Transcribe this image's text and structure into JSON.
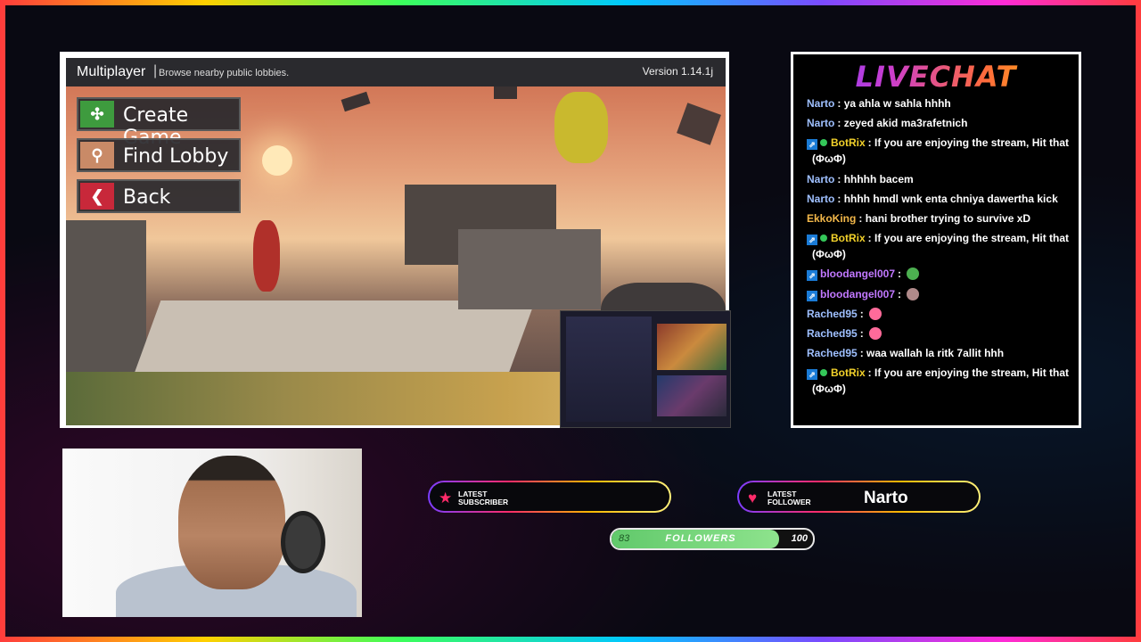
{
  "game": {
    "title": "Multiplayer",
    "separator": "|",
    "subtitle": "Browse nearby public lobbies.",
    "version": "Version 1.14.1j",
    "menu": [
      {
        "label": "Create Game",
        "icon": "network-icon",
        "color": "#3e9b3e"
      },
      {
        "label": "Find Lobby",
        "icon": "search-icon",
        "color": "#c98a67"
      },
      {
        "label": "Back",
        "icon": "back-arrow-icon",
        "color": "#c8283a"
      }
    ]
  },
  "livechat": {
    "title": "LIVECHAT",
    "messages": [
      {
        "user": "Narto",
        "user_color": "#9fc0ff",
        "text": "ya ahla w sahla hhhh"
      },
      {
        "user": "Narto",
        "user_color": "#9fc0ff",
        "text": "zeyed akid ma3rafetnich"
      },
      {
        "user": "BotRix",
        "user_color": "#f2d12a",
        "bot": true,
        "text": "If you are enjoying the stream, Hit that",
        "text2": "(ΦωΦ)"
      },
      {
        "user": "Narto",
        "user_color": "#9fc0ff",
        "text": "hhhhh bacem"
      },
      {
        "user": "Narto",
        "user_color": "#9fc0ff",
        "text": "hhhh hmdl wnk enta chniya dawertha kick"
      },
      {
        "user": "EkkoKing",
        "user_color": "#f3b84a",
        "text": "hani brother trying to survive xD"
      },
      {
        "user": "BotRix",
        "user_color": "#f2d12a",
        "bot": true,
        "text": "If you are enjoying the stream, Hit that",
        "text2": "(ΦωΦ)"
      },
      {
        "user": "bloodangel007",
        "user_color": "#c178ff",
        "badge": true,
        "text": "",
        "emote": "green-face"
      },
      {
        "user": "bloodangel007",
        "user_color": "#c178ff",
        "badge": true,
        "text": "",
        "emote": "cat-face"
      },
      {
        "user": "Rached95",
        "user_color": "#9fc0ff",
        "text": "",
        "emote": "pink-feather"
      },
      {
        "user": "Rached95",
        "user_color": "#9fc0ff",
        "text": "",
        "emote": "pink-feather"
      },
      {
        "user": "Rached95",
        "user_color": "#9fc0ff",
        "text": "waa wallah la ritk 7allit hhh"
      },
      {
        "user": "BotRix",
        "user_color": "#f2d12a",
        "bot": true,
        "text": "If you are enjoying the stream, Hit that",
        "text2": "(ΦωΦ)"
      }
    ]
  },
  "widgets": {
    "latest_subscriber": {
      "tag_line1": "LATEST",
      "tag_line2": "SUBSCRIBER",
      "value": ""
    },
    "latest_follower": {
      "tag_line1": "LATEST",
      "tag_line2": "FOLLOWER",
      "value": "Narto"
    },
    "followers_goal": {
      "current": "83",
      "label": "FOLLOWERS",
      "max": "100",
      "progress": 0.83
    }
  },
  "colors": {
    "accent_pink": "#ff2b6a",
    "goal_green": "#61c96b"
  }
}
